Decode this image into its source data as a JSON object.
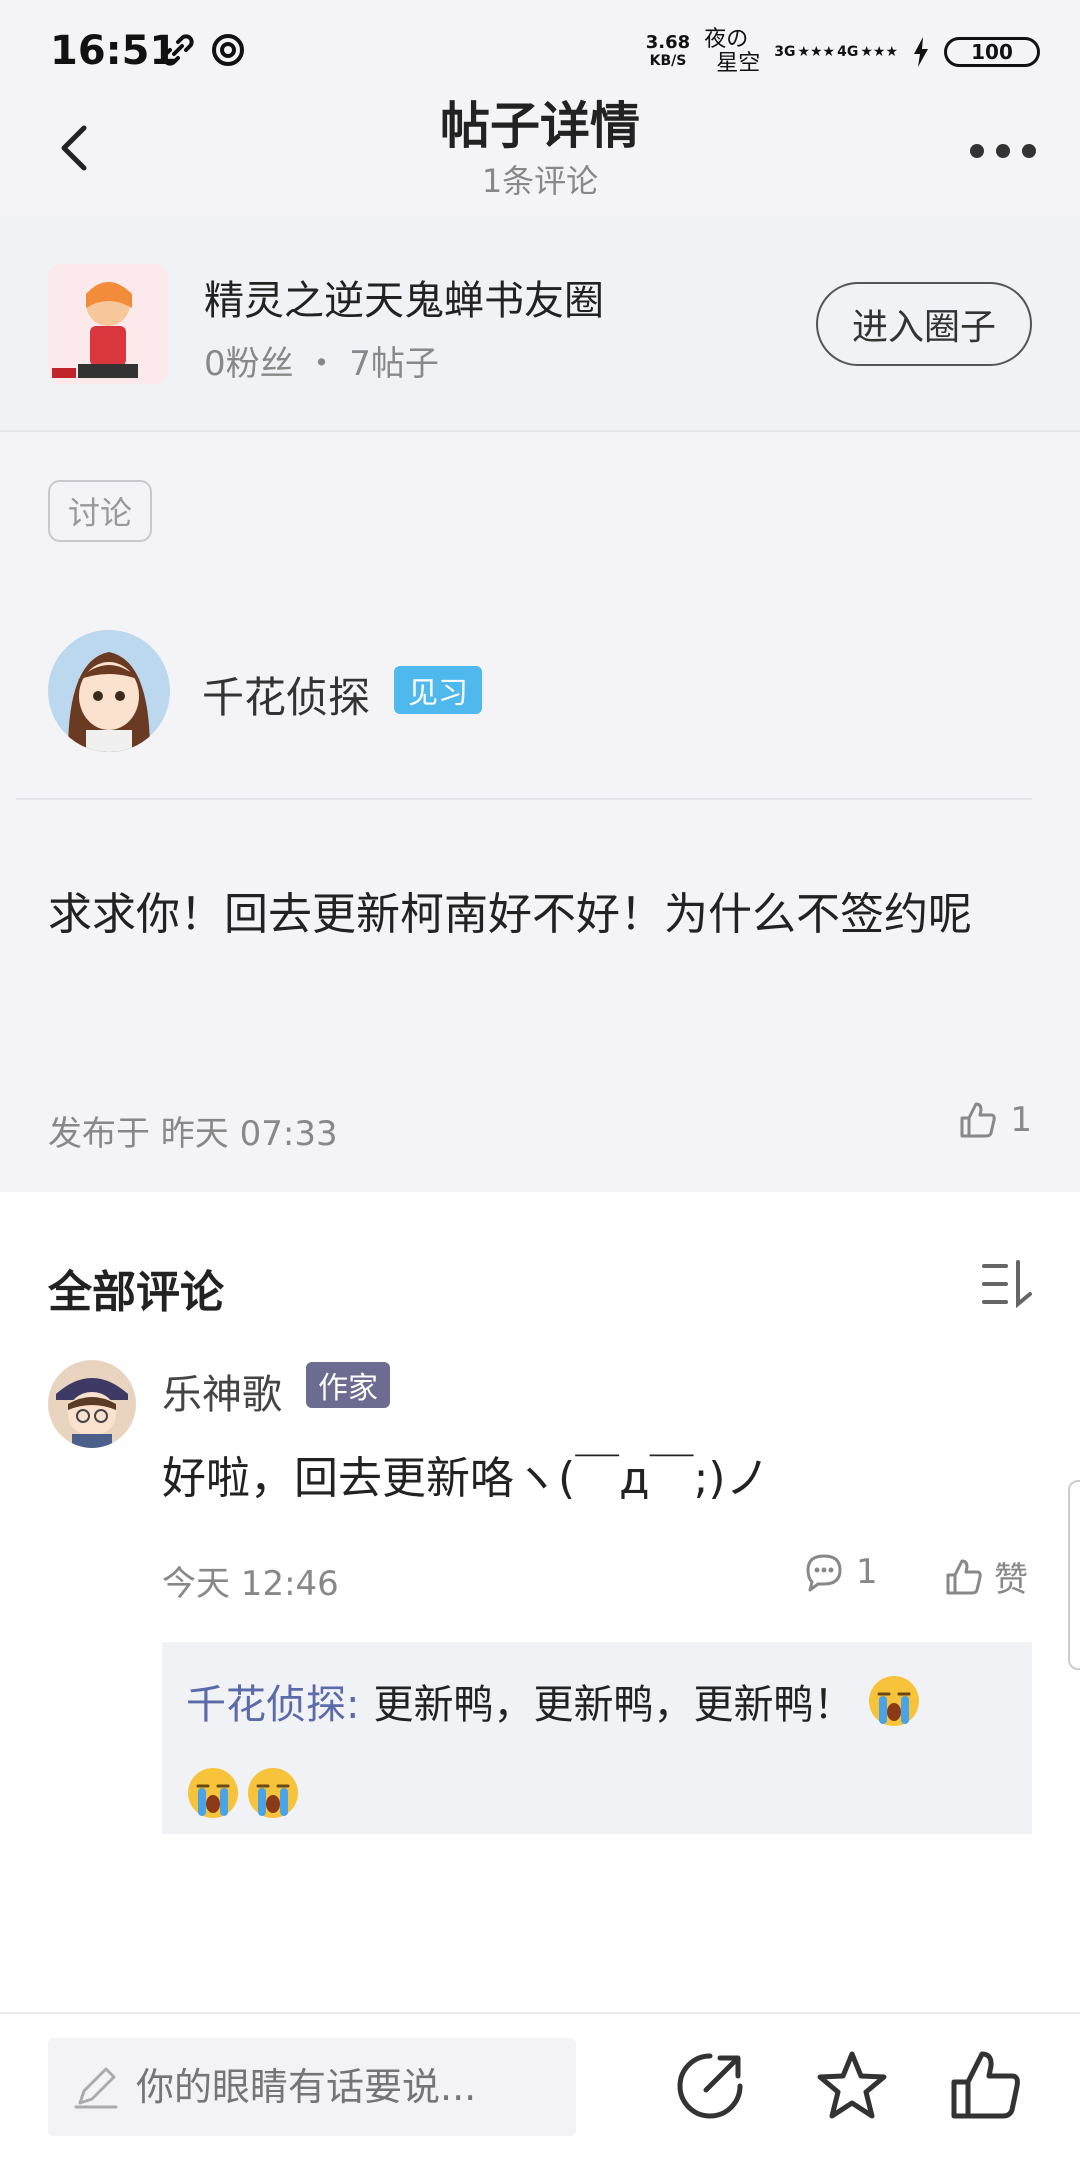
{
  "status_bar": {
    "time": "16:51",
    "net_speed_value": "3.68",
    "net_speed_unit": "KB/S",
    "carrier_line1": "夜の",
    "carrier_line2": "星空",
    "sig1": "3G",
    "sig2": "4G",
    "battery": "100"
  },
  "header": {
    "title": "帖子详情",
    "subtitle": "1条评论"
  },
  "circle": {
    "name": "精灵之逆天鬼蝉书友圈",
    "stats": "0粉丝 ・ 7帖子",
    "enter_label": "进入圈子"
  },
  "post": {
    "tag": "讨论",
    "author": "千花侦探",
    "author_badge": "见习",
    "text": "求求你！回去更新柯南好不好！为什么不签约呢",
    "date": "发布于 昨天 07:33",
    "likes": "1"
  },
  "comments": {
    "heading": "全部评论",
    "items": [
      {
        "name": "乐神歌",
        "badge": "作家",
        "text": "好啦，回去更新咯ヽ(￣д￣;)ノ",
        "time": "今天 12:46",
        "reply_count": "1",
        "like_label": "赞",
        "reply": {
          "author": "千花侦探:",
          "text": "更新鸭，更新鸭，更新鸭！"
        }
      }
    ]
  },
  "bottom": {
    "input_placeholder": "你的眼睛有话要说..."
  },
  "colors": {
    "accent_blue": "#4fb8ec",
    "author_badge": "#6c6b90",
    "reply_author": "#5b6aa8"
  }
}
